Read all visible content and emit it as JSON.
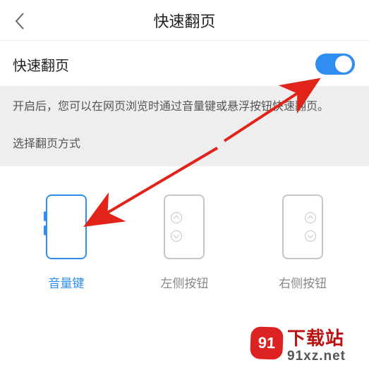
{
  "header": {
    "title": "快速翻页"
  },
  "setting": {
    "label": "快速翻页",
    "toggle_on": true
  },
  "description": "开启后，您可以在网页浏览时通过音量键或悬浮按钮快速翻页。",
  "choose_label": "选择翻页方式",
  "options": [
    {
      "label": "音量键",
      "active": true,
      "kind": "volume"
    },
    {
      "label": "左侧按钮",
      "active": false,
      "kind": "left"
    },
    {
      "label": "右侧按钮",
      "active": false,
      "kind": "right"
    }
  ],
  "watermark": {
    "badge": "91",
    "line1": "下载站",
    "line2": "91xz.net"
  },
  "colors": {
    "accent": "#2f8ef0",
    "arrow": "#e2231a"
  }
}
